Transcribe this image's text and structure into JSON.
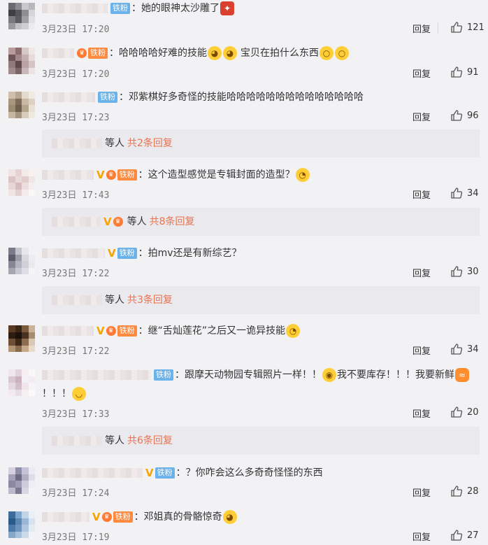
{
  "comments": [
    {
      "date": "3月23日 17:20",
      "text": "她的眼神太沙雕了",
      "badge": "铁粉",
      "badge_color": "blue",
      "reply": "回复",
      "likes": "121"
    },
    {
      "date": "3月23日 17:20",
      "text": "哈哈哈哈好难的技能",
      "text2": "宝贝在拍什么东西",
      "badge": "铁粉",
      "badge_color": "orange",
      "reply": "回复",
      "likes": "91"
    },
    {
      "date": "3月23日 17:23",
      "text": "邓紫棋好多奇怪的技能哈哈哈哈哈哈哈哈哈哈哈哈哈哈",
      "badge": "铁粉",
      "badge_color": "blue",
      "reply": "回复",
      "likes": "96",
      "sub_suffix": "等人",
      "sub_total": "共2条回复"
    },
    {
      "date": "3月23日 17:43",
      "text": "这个造型感觉是专辑封面的造型？",
      "badge": "铁粉",
      "badge_color": "orange",
      "reply": "回复",
      "likes": "34",
      "sub_suffix": "等人",
      "sub_total": "共8条回复"
    },
    {
      "date": "3月23日 17:22",
      "text": "拍mv还是有新综艺？",
      "badge": "铁粉",
      "badge_color": "blue",
      "reply": "回复",
      "likes": "30",
      "sub_suffix": "等人",
      "sub_total": "共3条回复"
    },
    {
      "date": "3月23日 17:22",
      "text": "继“舌灿莲花”之后又一诡异技能",
      "badge": "铁粉",
      "badge_color": "orange",
      "reply": "回复",
      "likes": "34"
    },
    {
      "date": "3月23日 17:33",
      "text": "跟摩天动物园专辑照片一样！！",
      "text2": "我不要库存！！！我要新鲜",
      "text3": "！！！",
      "badge": "铁粉",
      "badge_color": "blue",
      "reply": "回复",
      "likes": "20",
      "sub_suffix": "等人",
      "sub_total": "共6条回复"
    },
    {
      "date": "3月23日 17:24",
      "text": "？你咋会这么多奇奇怪怪的东西",
      "badge": "铁粉",
      "badge_color": "blue",
      "reply": "回复",
      "likes": "28"
    },
    {
      "date": "3月23日 17:19",
      "text": "邓姐真的骨骼惊奇",
      "badge": "铁粉",
      "badge_color": "orange",
      "reply": "回复",
      "likes": "27"
    }
  ],
  "colors": {
    "background": "#f2f2f5",
    "link": "#eb7350",
    "badge_blue": "#6ab2ea",
    "badge_orange": "#ff8a3d"
  }
}
